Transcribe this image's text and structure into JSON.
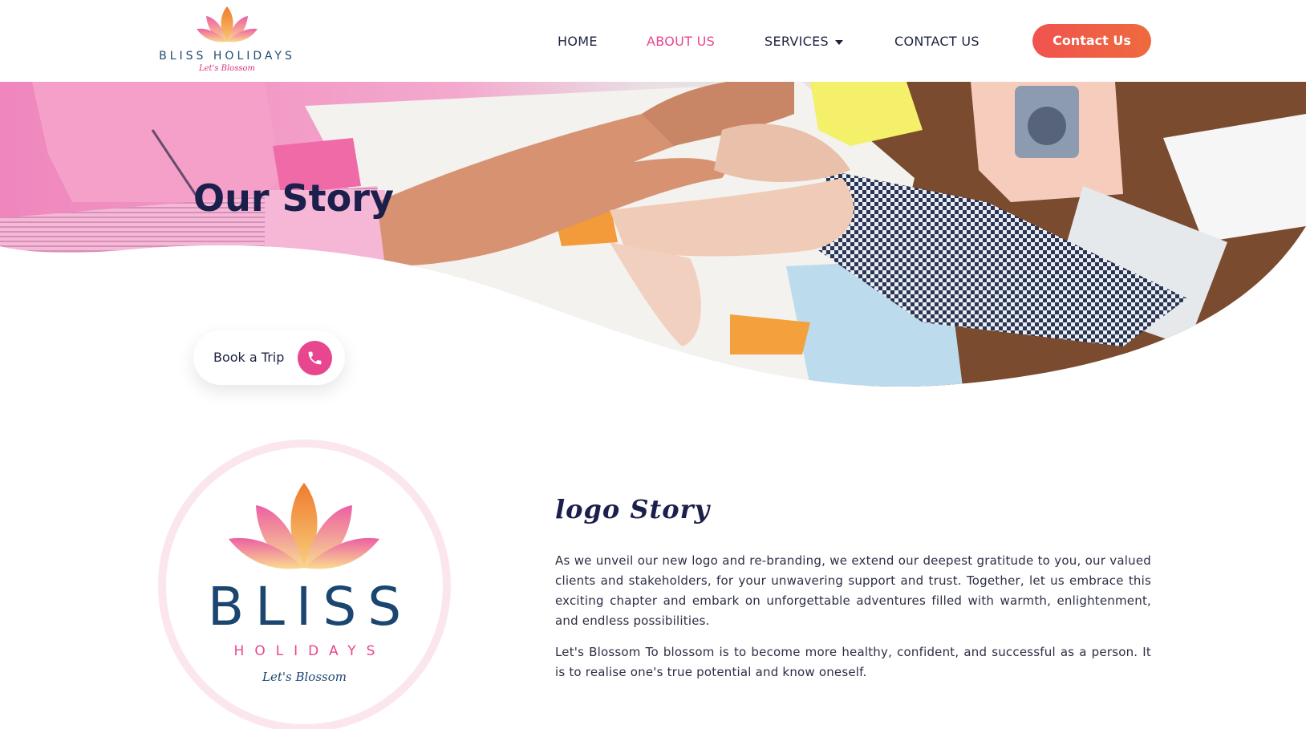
{
  "header": {
    "logo": {
      "brand": "BLISS HOLIDAYS",
      "tagline": "Let's Blossom"
    },
    "nav": [
      {
        "label": "HOME"
      },
      {
        "label": "ABOUT US"
      },
      {
        "label": "SERVICES"
      },
      {
        "label": "CONTACT US"
      }
    ],
    "active_nav": "ABOUT US",
    "cta_label": "Contact Us"
  },
  "hero": {
    "title": "Our Story",
    "book_label": "Book a Trip"
  },
  "story": {
    "logo": {
      "brand": "BLISS",
      "sub": "HOLIDAYS",
      "tagline": "Let's Blossom"
    },
    "heading": "logo Story",
    "paragraphs": [
      "As we unveil our new logo and re-branding, we extend our deepest gratitude to you, our valued clients and stakeholders, for your unwavering support and trust. Together, let us embrace this exciting chapter and embark on unforgettable adventures filled with warmth, enlightenment, and endless possibilities.",
      "Let's Blossom To blossom is to become more healthy, confident, and successful as a person. It is to realise one's true potential and know oneself."
    ]
  },
  "colors": {
    "accent_pink": "#e8468f",
    "cta_orange": "#f0534f",
    "navy": "#1a4670",
    "text_dark": "#1d2440"
  },
  "icons": [
    "lotus-logo-icon",
    "phone-icon",
    "chevron-down-icon"
  ]
}
